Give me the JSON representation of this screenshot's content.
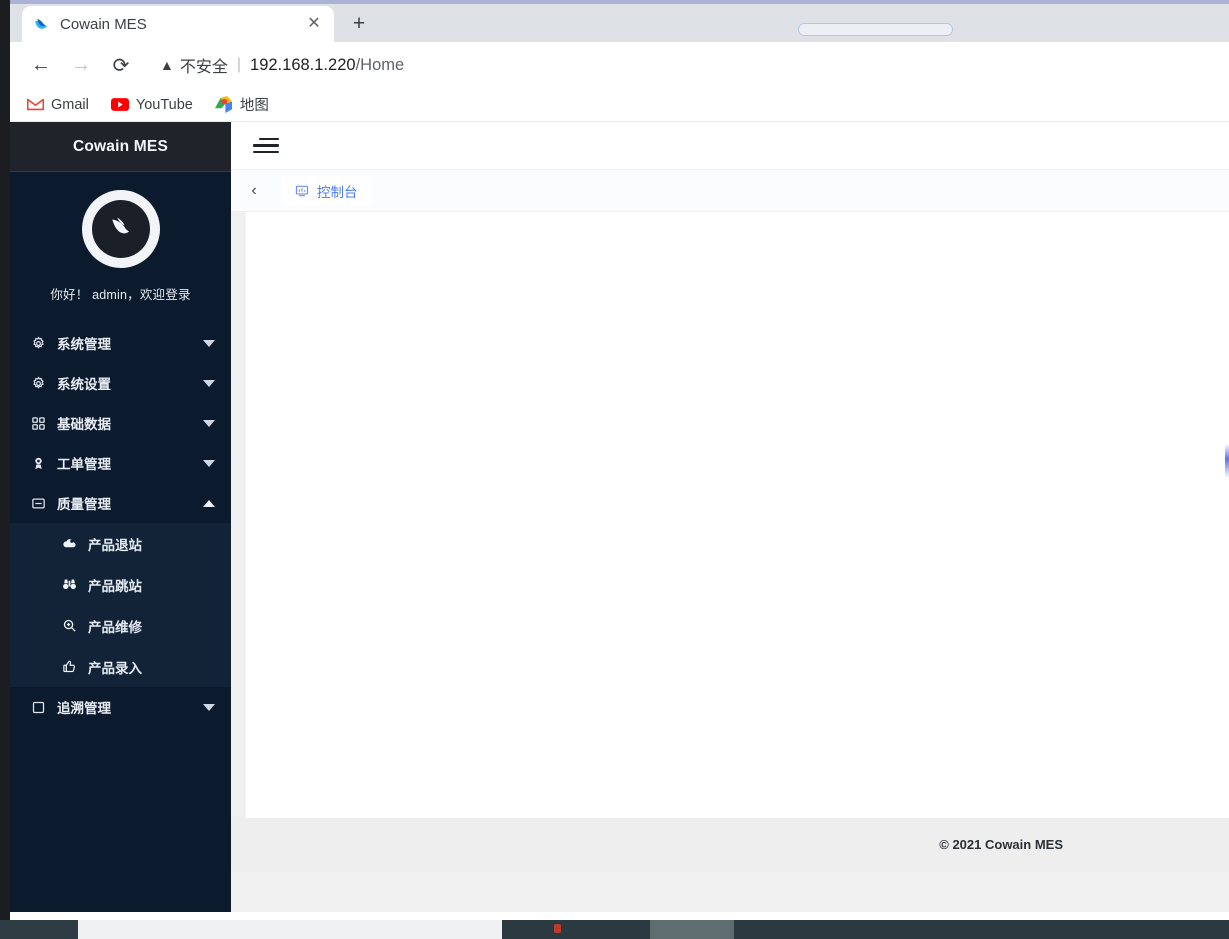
{
  "browser": {
    "tab": {
      "title": "Cowain MES",
      "favicon": "cowain-logo-icon",
      "close_label": "✕"
    },
    "new_tab_label": "+",
    "nav": {
      "back_label": "←",
      "forward_label": "→",
      "reload_label": "⟳"
    },
    "omnibox": {
      "warning_icon": "warning-triangle-icon",
      "warning_text": "不安全",
      "divider": "|",
      "url_host": "192.168.1.220",
      "url_path": "/Home"
    },
    "bookmarks": [
      {
        "label": "Gmail",
        "icon": "gmail-icon"
      },
      {
        "label": "YouTube",
        "icon": "youtube-icon"
      },
      {
        "label": "地图",
        "icon": "maps-icon"
      }
    ]
  },
  "sidebar": {
    "brand": "Cowain MES",
    "avatar_icon": "wing-logo-icon",
    "greeting": "你好！ admin，欢迎登录",
    "items": [
      {
        "label": "系统管理",
        "icon": "gear-icon",
        "expanded": false
      },
      {
        "label": "系统设置",
        "icon": "gear-icon",
        "expanded": false
      },
      {
        "label": "基础数据",
        "icon": "grid-icon",
        "expanded": false
      },
      {
        "label": "工单管理",
        "icon": "award-icon",
        "expanded": false
      },
      {
        "label": "质量管理",
        "icon": "window-icon",
        "expanded": true
      },
      {
        "label": "追溯管理",
        "icon": "square-icon",
        "expanded": false
      }
    ],
    "submenu": [
      {
        "label": "产品退站",
        "icon": "cloud-icon"
      },
      {
        "label": "产品跳站",
        "icon": "binoculars-icon"
      },
      {
        "label": "产品维修",
        "icon": "search-icon"
      },
      {
        "label": "产品录入",
        "icon": "thumbs-up-icon"
      }
    ]
  },
  "main": {
    "menu_toggle_icon": "hamburger-indent-icon",
    "tab_scroll_left_label": "‹",
    "tabs": [
      {
        "label": "控制台",
        "icon": "monitor-icon",
        "active": true
      }
    ],
    "footer_text": "© 2021 Cowain MES"
  },
  "colors": {
    "sidebar_bg": "#0b1a2d",
    "sidebar_header_bg": "#20232a",
    "submenu_bg": "#122337",
    "accent_blue": "#4a7cf7",
    "footer_bg": "#eeeeee"
  }
}
